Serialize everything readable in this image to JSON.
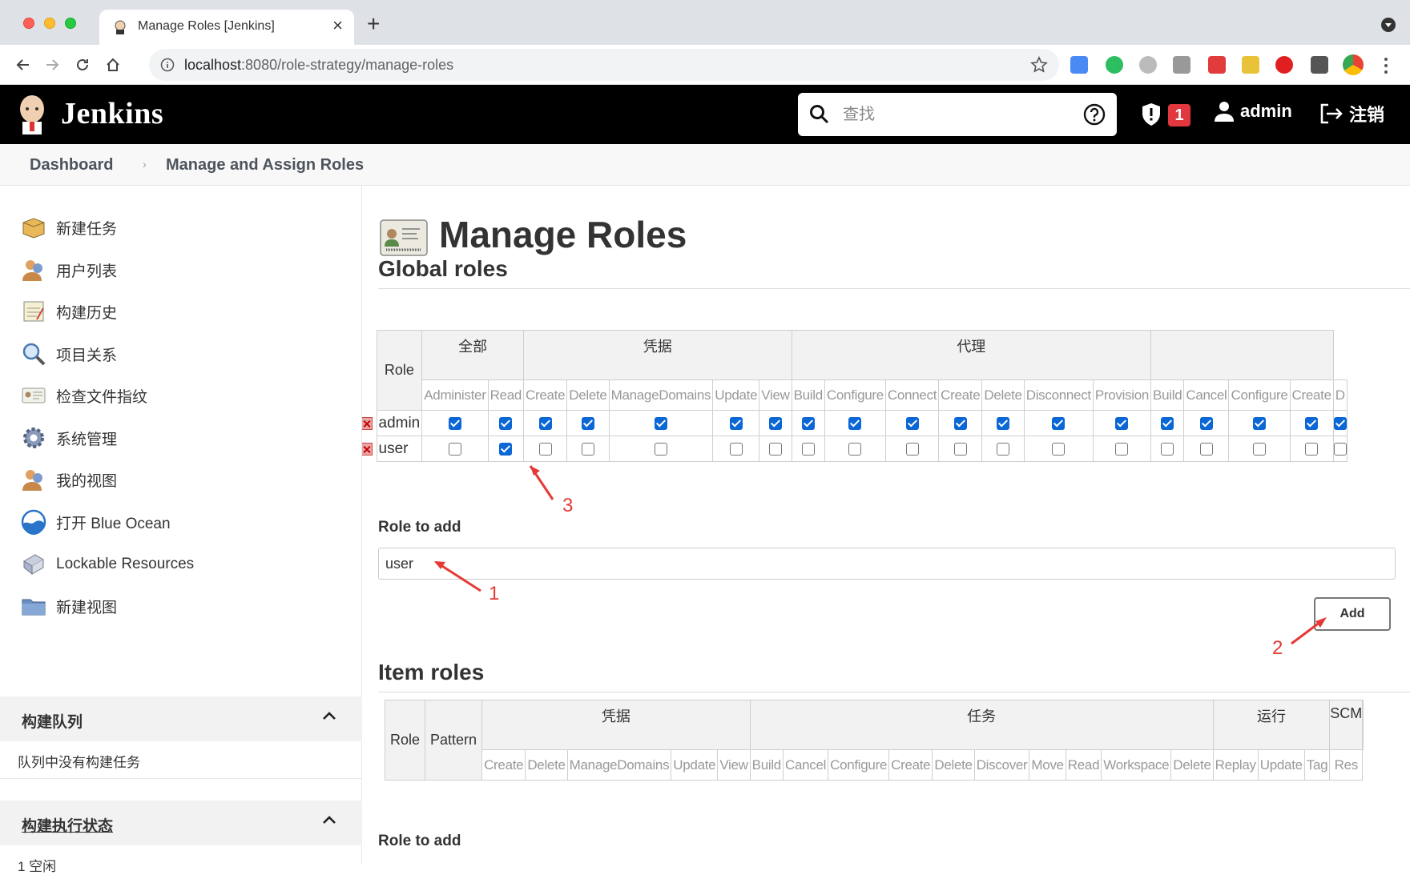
{
  "browser": {
    "tab_title": "Manage Roles [Jenkins]",
    "url_host": "localhost",
    "url_path": ":8080/role-strategy/manage-roles"
  },
  "header": {
    "brand": "Jenkins",
    "search_placeholder": "查找",
    "alert_count": "1",
    "user": "admin",
    "logout": "注销"
  },
  "breadcrumb": [
    "Dashboard",
    "Manage and Assign Roles"
  ],
  "sidebar": {
    "items": [
      {
        "label": "新建任务",
        "icon": "new-item-icon"
      },
      {
        "label": "用户列表",
        "icon": "users-icon"
      },
      {
        "label": "构建历史",
        "icon": "notepad-icon"
      },
      {
        "label": "项目关系",
        "icon": "magnifier-icon"
      },
      {
        "label": "检查文件指纹",
        "icon": "fingerprint-icon"
      },
      {
        "label": "系统管理",
        "icon": "gear-icon"
      },
      {
        "label": "我的视图",
        "icon": "users-icon"
      },
      {
        "label": "打开 Blue Ocean",
        "icon": "blue-ocean-icon"
      },
      {
        "label": "Lockable Resources",
        "icon": "lock-resources-icon"
      },
      {
        "label": "新建视图",
        "icon": "folder-icon"
      }
    ],
    "build_queue": {
      "title": "构建队列",
      "empty": "队列中没有构建任务"
    },
    "executors": {
      "title": "构建执行状态",
      "first": "1 空闲"
    }
  },
  "main": {
    "title": "Manage Roles",
    "global_roles": {
      "title": "Global roles",
      "role_header": "Role",
      "groups": [
        {
          "label": "全部",
          "span": 2
        },
        {
          "label": "凭据",
          "span": 5
        },
        {
          "label": "代理",
          "span": 7
        },
        {
          "label": "",
          "span": 4
        }
      ],
      "permissions": [
        "Administer",
        "Read",
        "Create",
        "Delete",
        "ManageDomains",
        "Update",
        "View",
        "Build",
        "Configure",
        "Connect",
        "Create",
        "Delete",
        "Disconnect",
        "Provision",
        "Build",
        "Cancel",
        "Configure",
        "Create",
        "D"
      ],
      "rows": [
        {
          "name": "admin",
          "checks": [
            true,
            true,
            true,
            true,
            true,
            true,
            true,
            true,
            true,
            true,
            true,
            true,
            true,
            true,
            true,
            true,
            true,
            true,
            true
          ]
        },
        {
          "name": "user",
          "checks": [
            false,
            true,
            false,
            false,
            false,
            false,
            false,
            false,
            false,
            false,
            false,
            false,
            false,
            false,
            false,
            false,
            false,
            false,
            false
          ]
        }
      ]
    },
    "role_to_add_label": "Role to add",
    "role_to_add_value": "user",
    "add_button": "Add",
    "item_roles": {
      "title": "Item roles",
      "role_header": "Role",
      "pattern_header": "Pattern",
      "groups": [
        {
          "label": "凭据",
          "span": 5
        },
        {
          "label": "任务",
          "span": 10
        },
        {
          "label": "运行",
          "span": 3
        },
        {
          "label": "SCM",
          "span": 1
        },
        {
          "label": "",
          "span": 1
        }
      ],
      "permissions": [
        "Create",
        "Delete",
        "ManageDomains",
        "Update",
        "View",
        "Build",
        "Cancel",
        "Configure",
        "Create",
        "Delete",
        "Discover",
        "Move",
        "Read",
        "Workspace",
        "Delete",
        "Replay",
        "Update",
        "Tag",
        "Res"
      ]
    },
    "role_to_add_label_2": "Role to add",
    "annotations": [
      "1",
      "2",
      "3"
    ]
  }
}
